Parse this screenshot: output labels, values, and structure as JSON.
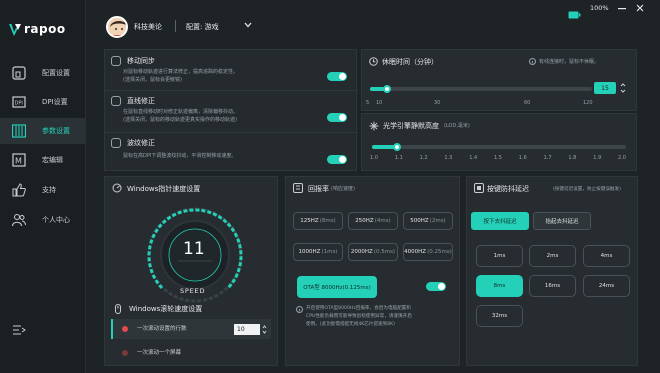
{
  "app": {
    "brand": "rapoo"
  },
  "battery": {
    "percent": "100%"
  },
  "sidebar": {
    "items": [
      {
        "label": "配置设置",
        "icon": "config-icon"
      },
      {
        "label": "DPI设置",
        "icon": "dpi-icon"
      },
      {
        "label": "参数设置",
        "icon": "params-icon"
      },
      {
        "label": "宏编辑",
        "icon": "macro-icon"
      },
      {
        "label": "支持",
        "icon": "thumb-up-icon"
      },
      {
        "label": "个人中心",
        "icon": "user-icon"
      }
    ]
  },
  "header": {
    "user_name": "科技美论",
    "config_label": "配置: 游戏"
  },
  "motion_sync": {
    "title": "移动同步",
    "desc1": "对鼠标移动轨迹进行算法修正，提高追踪的稳定性。",
    "desc2": "(选择关闭，鼠标会更敏锐)"
  },
  "line_correction": {
    "title": "直线修正",
    "desc1": "在鼠标直线移动时对修正轨迹偏离，清除偏移抖动。",
    "desc2": "(选择关闭，鼠标的移动轨迹更真实操作的移动轨迹)"
  },
  "ripple_correction": {
    "title": "波纹修正",
    "desc1": "鼠标在高DPI下调整波纹抖动，平滑控制移动速度。"
  },
  "sleep": {
    "title": "休眠时间（分钟）",
    "hint": "有线连接时，鼠标不休眠。",
    "value": "15",
    "min": "5",
    "ticks": [
      "10",
      "30",
      "60",
      "120"
    ]
  },
  "lod": {
    "title": "光学引擎静默高度",
    "unit": "(LOD,毫米)",
    "ticks": [
      "1.0",
      "1.1",
      "1.2",
      "1.3",
      "1.4",
      "1.5",
      "1.6",
      "1.7",
      "1.8",
      "1.9",
      "2.0"
    ]
  },
  "pointer_speed": {
    "title": "Windows指针速度设置",
    "value": "11",
    "gauge_label": "SPEED",
    "scroll_title": "Windows滚轮速度设置",
    "scroll_opt1": "一次滚动设置的行数",
    "scroll_lines": "10",
    "scroll_opt2": "一次滚动一个屏幕"
  },
  "report_rate": {
    "title": "回报率",
    "title_sub": "(响应速度)",
    "options": [
      {
        "label": "125HZ",
        "sub": "(8ms)"
      },
      {
        "label": "250HZ",
        "sub": "(4ms)"
      },
      {
        "label": "500HZ",
        "sub": "(2ms)"
      },
      {
        "label": "1000HZ",
        "sub": "(1ms)"
      },
      {
        "label": "2000HZ",
        "sub": "(0.5ms)"
      },
      {
        "label": "4000HZ",
        "sub": "(0.25ms)"
      }
    ],
    "ota_label": "OTA型 8000Hz(0.125ms)",
    "note1": "开启使用OTA型8000Hz回报率，会因为电脑配置和",
    "note2": "CPU性能负载而可能导致鼠标使用异常，请谨慎开启",
    "note3": "使用。(此功能需搭配无线4K芯片搭速到8K)"
  },
  "debounce": {
    "title": "按键防抖延迟",
    "hint": "(按键延迟设置，防止按键误触发)",
    "tab_press": "按下去抖延迟",
    "tab_release": "抬起去抖延迟",
    "options": [
      "1ms",
      "2ms",
      "4ms",
      "8ms",
      "16ms",
      "24ms",
      "32ms"
    ]
  },
  "colors": {
    "accent": "#24d1b8",
    "bg": "#1e2326",
    "panel": "#262c30"
  }
}
